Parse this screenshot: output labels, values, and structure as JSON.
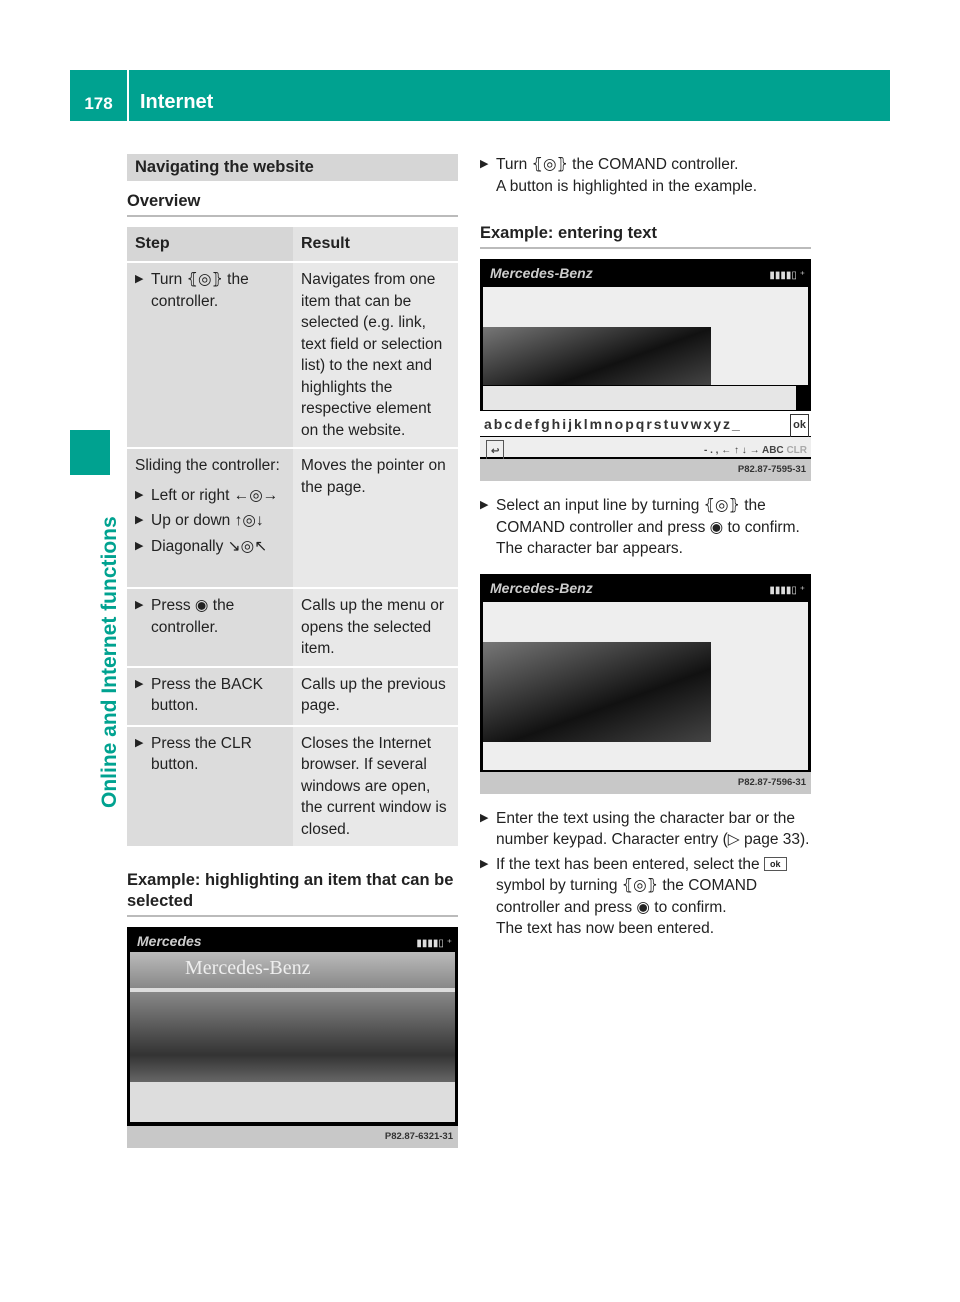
{
  "header": {
    "page_number": "178",
    "title": "Internet"
  },
  "sidebar": {
    "section": "Online and Internet functions"
  },
  "left": {
    "section_title": "Navigating the website",
    "overview_heading": "Overview",
    "table": {
      "headers": [
        "Step",
        "Result"
      ],
      "rows": [
        {
          "step_intro": "",
          "steps": [
            "Turn ⦃◎⦄ the controller."
          ],
          "result": "Navigates from one item that can be selected (e.g. link, text field or selection list) to the next and highlights the respective element on the website."
        },
        {
          "step_intro": "Sliding the controller:",
          "steps": [
            "Left or right ←◎→",
            "Up or down ↑◎↓",
            "Diagonally ↘◎↖"
          ],
          "result": "Moves the pointer on the page."
        },
        {
          "step_intro": "",
          "steps": [
            "Press ◉ the controller."
          ],
          "result": "Calls up the menu or opens the selected item."
        },
        {
          "step_intro": "",
          "steps": [
            "Press the BACK button."
          ],
          "result": "Calls up the previous page."
        },
        {
          "step_intro": "",
          "steps": [
            "Press the CLR button."
          ],
          "result": "Closes the Internet browser. If several windows are open, the current window is closed."
        }
      ]
    },
    "example_heading": "Example: highlighting an item that can be selected",
    "image": {
      "brand": "Mercedes",
      "site_title": "Mercedes-Benz",
      "caption": "P82.87-6321-31"
    }
  },
  "right": {
    "step1": "Turn ⦃◎⦄ the COMAND controller.",
    "step1_result": "A button is highlighted in the example.",
    "example_heading": "Example: entering text",
    "image1": {
      "brand": "Mercedes-Benz",
      "charbar": "abcdefghijklmnopqrstuvwxyz_",
      "ok": "ok",
      "keys": "- . , ← ↑ ↓ → ABC",
      "clr": "CLR",
      "caption": "P82.87-7595-31"
    },
    "step2": "Select an input line by turning ⦃◎⦄ the COMAND controller and press ◉ to confirm.",
    "step2_result": "The character bar appears.",
    "image2": {
      "brand": "Mercedes-Benz",
      "caption": "P82.87-7596-31"
    },
    "step3": "Enter the text using the character bar or the number keypad. Character entry (▷ page 33).",
    "step4_a": "If the text has been entered, select the",
    "step4_key": "ok",
    "step4_b": "symbol by turning ⦃◎⦄ the COMAND controller and press ◉ to confirm.",
    "step4_result": "The text has now been entered."
  }
}
